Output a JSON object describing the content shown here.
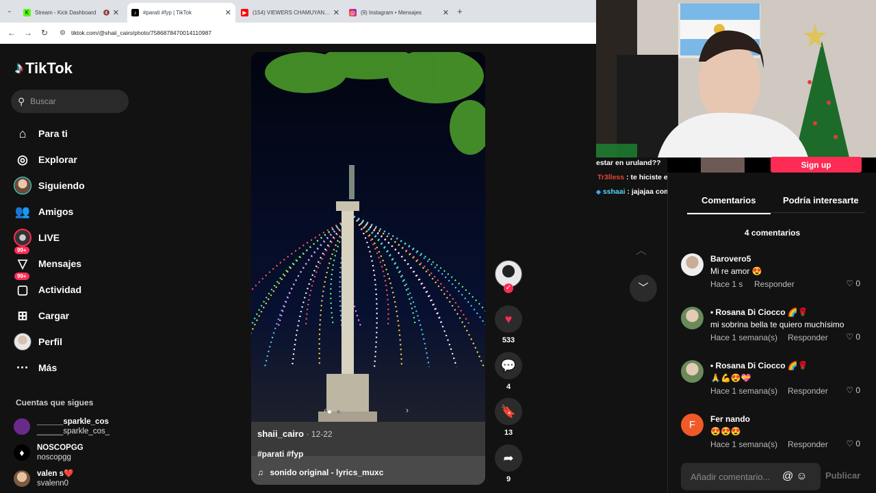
{
  "browser": {
    "tabs": [
      {
        "title": "Stream - Kick Dashboard",
        "icon": "kick-icon"
      },
      {
        "title": "#parati #fyp | TikTok",
        "icon": "tiktok-icon"
      },
      {
        "title": "(154) VIEWERS CHAMUYANDO...",
        "icon": "youtube-icon"
      },
      {
        "title": "(9) Instagram • Mensajes",
        "icon": "instagram-icon"
      }
    ],
    "url": "tiktok.com/@shaii_cairo/photo/7586878470014110987"
  },
  "sidebar": {
    "logo": "TikTok",
    "search_placeholder": "Buscar",
    "nav": [
      {
        "label": "Para ti",
        "icon": "home-icon"
      },
      {
        "label": "Explorar",
        "icon": "compass-icon"
      },
      {
        "label": "Siguiendo",
        "icon": "following-avatar"
      },
      {
        "label": "Amigos",
        "icon": "friends-icon"
      },
      {
        "label": "LIVE",
        "icon": "live-icon"
      },
      {
        "label": "Mensajes",
        "icon": "messages-icon",
        "badge": "99+"
      },
      {
        "label": "Actividad",
        "icon": "activity-icon",
        "badge": "99+"
      },
      {
        "label": "Cargar",
        "icon": "upload-icon"
      },
      {
        "label": "Perfil",
        "icon": "profile-avatar"
      },
      {
        "label": "Más",
        "icon": "more-icon"
      }
    ],
    "following_title": "Cuentas que sigues",
    "following": [
      {
        "name": "______sparkle_cos",
        "username": "______sparkle_cos_"
      },
      {
        "name": "NOSCOPGG",
        "username": "noscopgg"
      },
      {
        "name": "valen s❤️",
        "username": "svalenn0"
      }
    ]
  },
  "video": {
    "username": "shaii_cairo",
    "date": "· 12-22",
    "tags": "#parati #fyp",
    "sound": "sonido original - lyrics_muxc"
  },
  "actions": {
    "likes": "533",
    "comments": "4",
    "saves": "13",
    "shares": "9"
  },
  "chat": [
    {
      "user": "",
      "text": "estar en uruland??"
    },
    {
      "user": "Tr3lless",
      "text": " : te hiciste el corte a la moda"
    },
    {
      "user": "sshaai",
      "text": " : jajajaa comentaba"
    }
  ],
  "signup_label": "Sign up",
  "panel": {
    "tabs": [
      "Comentarios",
      "Podría interesarte"
    ],
    "count": "4 comentarios",
    "comments": [
      {
        "name": "Barovero5",
        "text": "Mi re amor 😍",
        "time": "Hace 1 s",
        "reply": "Responder",
        "likes": "0"
      },
      {
        "name": "• Rosana Di Ciocco 🌈🌹",
        "text": "mi sobrina bella te quiero muchísimo",
        "time": "Hace 1 semana(s)",
        "reply": "Responder",
        "likes": "0"
      },
      {
        "name": "• Rosana Di Ciocco 🌈🌹",
        "text": "🙏💪😍💝",
        "time": "Hace 1 semana(s)",
        "reply": "Responder",
        "likes": "0"
      },
      {
        "name": "Fer nando",
        "text": "😍😍😍",
        "time": "Hace 1 semana(s)",
        "reply": "Responder",
        "likes": "0",
        "avatar_letter": "F"
      }
    ],
    "input_placeholder": "Añadir comentario...",
    "publish": "Publicar"
  }
}
